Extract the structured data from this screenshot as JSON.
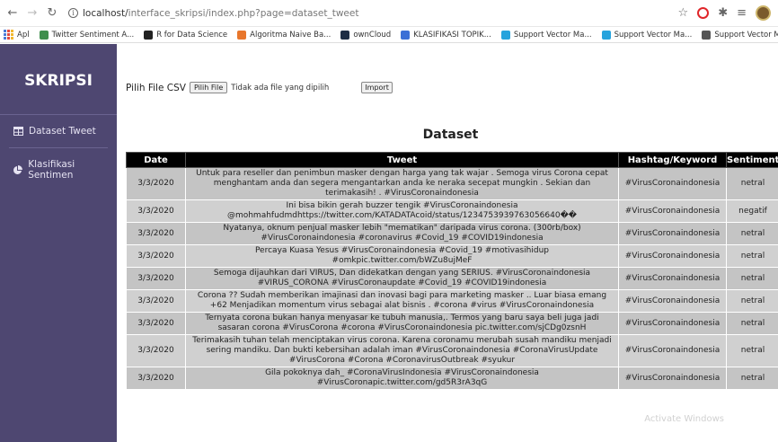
{
  "browser": {
    "url_host": "localhost/",
    "url_path": "interface_skripsi/index.php?page=dataset_tweet",
    "bookmarks": [
      {
        "label": "Apl",
        "color": "#4a7bd6"
      },
      {
        "label": "Twitter Sentiment A...",
        "color": "#3f8f4d"
      },
      {
        "label": "R for Data Science",
        "color": "#222222"
      },
      {
        "label": "Algoritma Naive Ba...",
        "color": "#e8762c"
      },
      {
        "label": "ownCloud",
        "color": "#1d2d44"
      },
      {
        "label": "KLASIFIKASI TOPIK...",
        "color": "#3b6fd6"
      },
      {
        "label": "Support Vector Ma...",
        "color": "#26a3dd"
      },
      {
        "label": "Support Vector Ma...",
        "color": "#26a3dd"
      },
      {
        "label": "Support Vector Ma...",
        "color": "#555555"
      }
    ]
  },
  "sidebar": {
    "brand": "SKRIPSI",
    "items": [
      {
        "label": "Dataset Tweet",
        "icon": "table-icon"
      },
      {
        "label": "Klasifikasi Sentimen",
        "icon": "pie-chart-icon"
      }
    ]
  },
  "upload": {
    "label": "Pilih File CSV",
    "choose_button": "Pilih File",
    "no_file_text": "Tidak ada file yang dipilih",
    "import_button": "Import"
  },
  "dataset": {
    "title": "Dataset",
    "columns": [
      "Date",
      "Tweet",
      "Hashtag/Keyword",
      "Sentiment"
    ],
    "rows": [
      {
        "date": "3/3/2020",
        "tweet": "Untuk para reseller dan penimbun masker dengan harga yang tak wajar . Semoga virus Corona cepat menghantam anda dan segera mengantarkan anda ke neraka secepat mungkin . Sekian dan terimakasih! . #VirusCoronaindonesia",
        "tag": "#VirusCoronaindonesia",
        "sentiment": "netral"
      },
      {
        "date": "3/3/2020",
        "tweet": "Ini bisa bikin gerah buzzer tengik #VirusCoronaindonesia @mohmahfudmdhttps://twitter.com/KATADATAcoid/status/1234753939763056640��",
        "tag": "#VirusCoronaindonesia",
        "sentiment": "negatif"
      },
      {
        "date": "3/3/2020",
        "tweet": "Nyatanya, oknum penjual masker lebih \"mematikan\" daripada virus corona. (300rb/box) #VirusCoronaindonesia #coronavirus #Covid_19 #COVID19indonesia",
        "tag": "#VirusCoronaindonesia",
        "sentiment": "netral"
      },
      {
        "date": "3/3/2020",
        "tweet": "Percaya Kuasa Yesus #VirusCoronaindonesia #Covid_19 #motivasihidup #omkpic.twitter.com/bWZu8ujMeF",
        "tag": "#VirusCoronaindonesia",
        "sentiment": "netral"
      },
      {
        "date": "3/3/2020",
        "tweet": "Semoga dijauhkan dari VIRUS, Dan didekatkan dengan yang SERIUS. #VirusCoronaindonesia #VIRUS_CORONA #VirusCoronaupdate #Covid_19 #COVID19indonesia",
        "tag": "#VirusCoronaindonesia",
        "sentiment": "netral"
      },
      {
        "date": "3/3/2020",
        "tweet": "Corona ?? Sudah memberikan imajinasi dan inovasi bagi para marketing masker .. Luar biasa emang +62 Menjadikan momentum virus sebagai alat bisnis . #corona #virus #VirusCoronaindonesia",
        "tag": "#VirusCoronaindonesia",
        "sentiment": "netral"
      },
      {
        "date": "3/3/2020",
        "tweet": "Ternyata corona bukan hanya menyasar ke tubuh manusia,. Termos yang baru saya beli juga jadi sasaran corona #VirusCorona #corona #VirusCoronaindonesia pic.twitter.com/sjCDg0zsnH",
        "tag": "#VirusCoronaindonesia",
        "sentiment": "netral"
      },
      {
        "date": "3/3/2020",
        "tweet": "Terimakasih tuhan telah menciptakan virus corona. Karena coronamu merubah susah mandiku menjadi sering mandiku. Dan bukti kebersihan adalah iman #VirusCoronaindonesia #CoronaVirusUpdate #VirusCorona #Corona #CoronavirusOutbreak #syukur",
        "tag": "#VirusCoronaindonesia",
        "sentiment": "netral"
      },
      {
        "date": "3/3/2020",
        "tweet": "Gila pokoknya dah_ #CoronaVirusIndonesia #VirusCoronaindonesia #VirusCoronapic.twitter.com/gd5R3rA3qG",
        "tag": "#VirusCoronaindonesia",
        "sentiment": "netral"
      }
    ]
  },
  "watermark": "Activate Windows"
}
